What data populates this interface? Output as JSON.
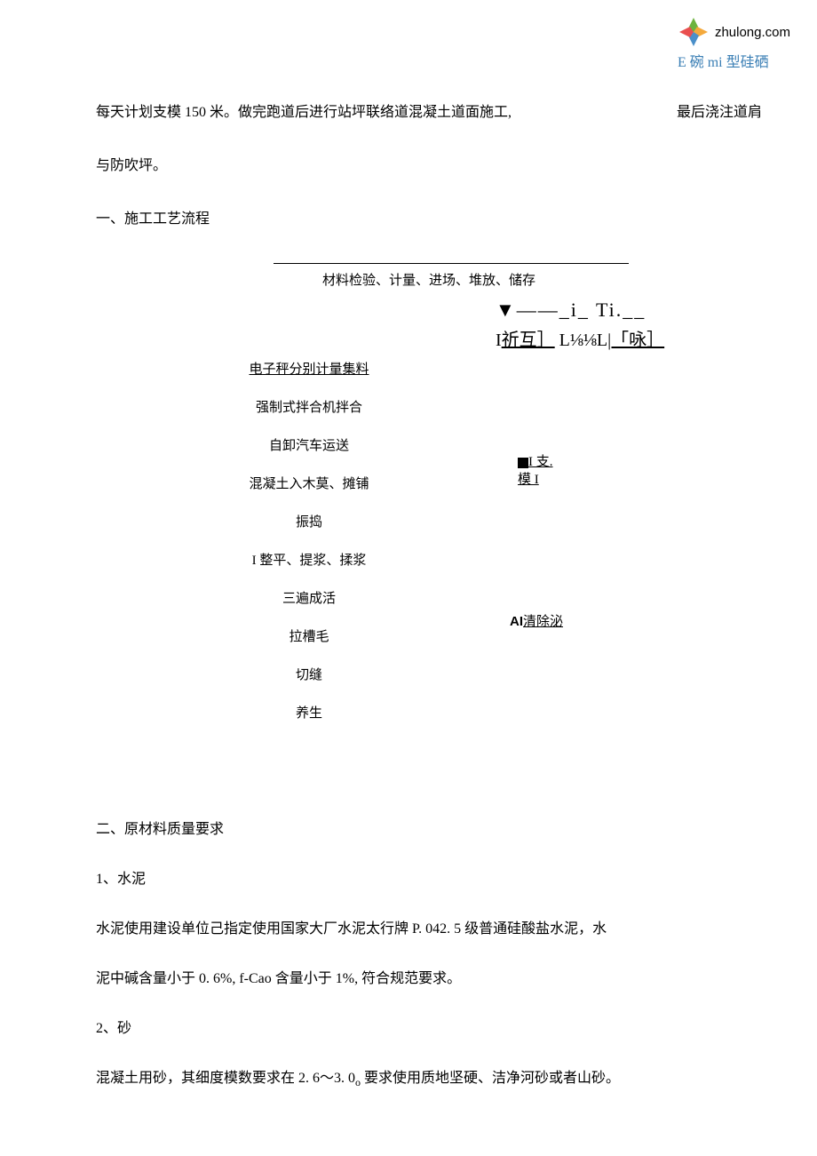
{
  "watermark": {
    "site": "zhulong.com",
    "tagline_e": "E",
    "tagline_bowl": " 碗 ",
    "tagline_mi": "mi",
    "tagline_rest": " 型硅硒"
  },
  "intro": {
    "line1": "每天计划支模 150 米。做完跑道后进行站坪联络道混凝土道面施工,",
    "line1_right": "最后浇注道肩",
    "line2": "与防吹坪。"
  },
  "section1": {
    "title": "一、施工工艺流程",
    "top": "材料检验、计量、进场、堆放、储存",
    "symbols_line1": "▼——_i_      Ti.__",
    "symbols_line2_a": "I",
    "symbols_line2_b": "祈互］",
    "symbols_line2_c": "L⅛⅛L",
    "symbols_line2_d": "|「咏］",
    "steps": [
      "电子秤分别计量集料",
      "强制式拌合机拌合",
      "自卸汽车运送",
      "混凝土入木莫、摊铺",
      "振捣",
      "I 整平、提浆、揉浆",
      "三遍成活",
      "拉槽毛",
      "切缝",
      "养生"
    ],
    "side1_a": "I 支.",
    "side1_b": "模 I",
    "side2_a": "AI",
    "side2_b": "清除泌"
  },
  "section2": {
    "title": "二、原材料质量要求",
    "item1_title": "1、水泥",
    "item1_p1": "水泥使用建设单位己指定使用国家大厂水泥太行牌 P. 042. 5 级普通硅酸盐水泥，水",
    "item1_p2": "泥中碱含量小于 0. 6%, f-Cao 含量小于 1%, 符合规范要求。",
    "item2_title": "2、砂",
    "item2_p1_a": "混凝土用砂，其细度模数要求在 2. 6～3. 0",
    "item2_p1_sub": "o",
    "item2_p1_b": " 要求使用质地坚硬、洁净河砂或者山砂。"
  }
}
